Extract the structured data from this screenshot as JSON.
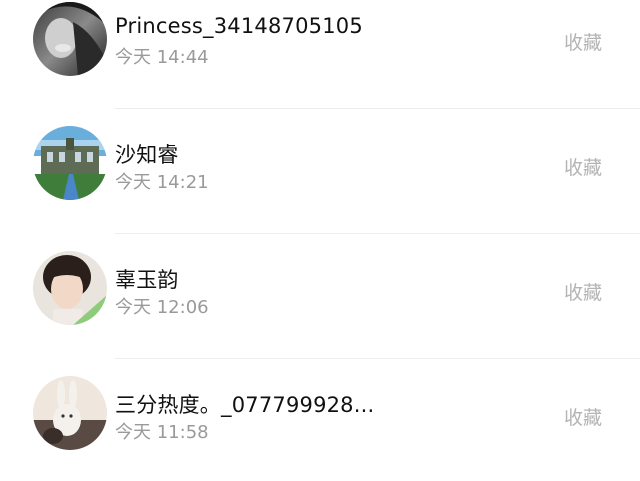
{
  "items": [
    {
      "name": "Princess_34148705105",
      "time": "今天 14:44",
      "action": "收藏",
      "avatar": "grayscale-portrait-avatar"
    },
    {
      "name": "沙知睿",
      "time": "今天 14:21",
      "action": "收藏",
      "avatar": "castle-landscape-avatar"
    },
    {
      "name": "辜玉韵",
      "time": "今天 12:06",
      "action": "收藏",
      "avatar": "girl-portrait-avatar"
    },
    {
      "name": "三分热度。_077799928...",
      "time": "今天 11:58",
      "action": "收藏",
      "avatar": "rabbit-photo-avatar"
    }
  ]
}
